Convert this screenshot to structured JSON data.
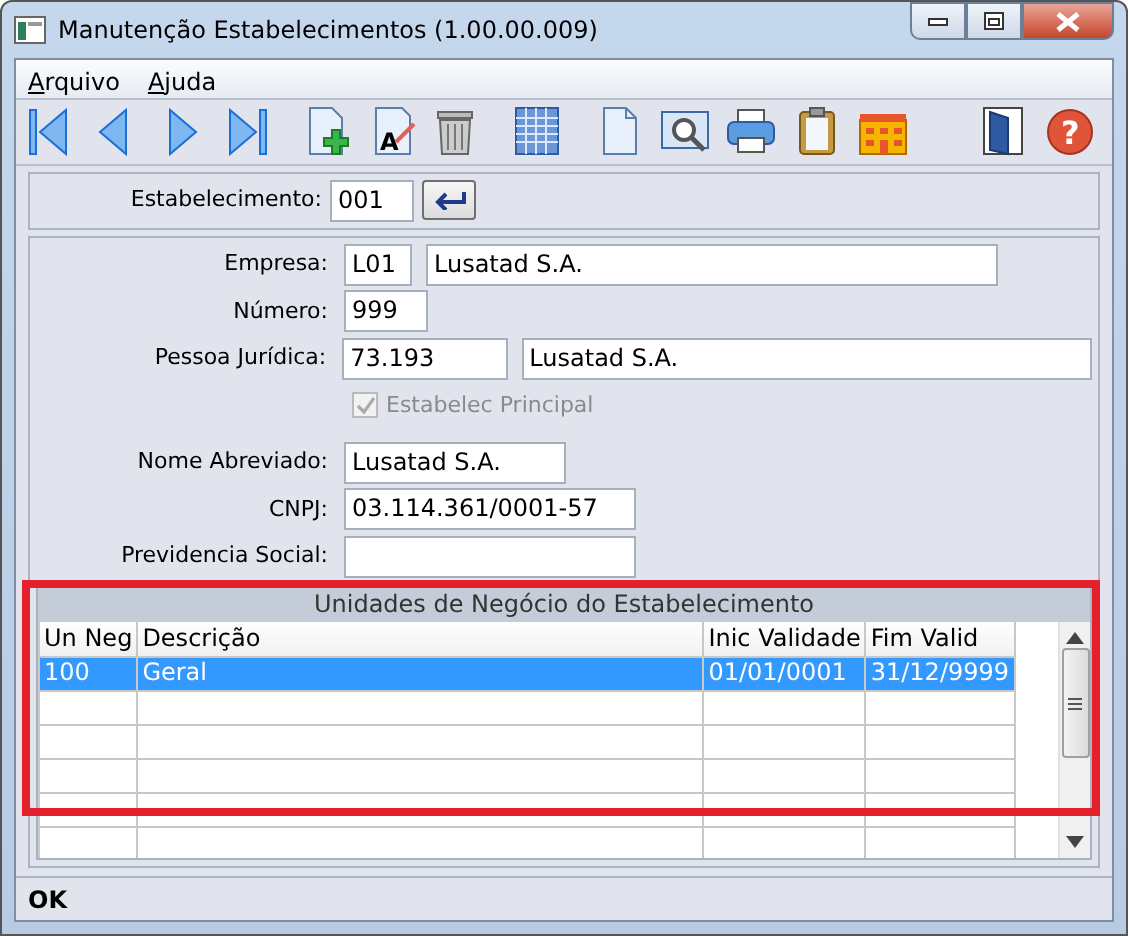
{
  "window": {
    "title": "Manutenção Estabelecimentos (1.00.00.009)"
  },
  "menu": [
    {
      "label": "Arquivo"
    },
    {
      "label": "Ajuda"
    }
  ],
  "toolbar": [
    {
      "kind": "first"
    },
    {
      "kind": "previous"
    },
    {
      "kind": "next"
    },
    {
      "kind": "last"
    },
    {
      "kind": "add"
    },
    {
      "kind": "edit",
      "glyph": "A"
    },
    {
      "kind": "trash"
    },
    {
      "kind": "grid"
    },
    {
      "kind": "document"
    },
    {
      "kind": "preview"
    },
    {
      "kind": "printer"
    },
    {
      "kind": "clipboard"
    },
    {
      "kind": "building"
    },
    {
      "kind": "door"
    },
    {
      "kind": "help",
      "glyph": "?"
    }
  ],
  "lookup": {
    "label": "Estabelecimento:",
    "value": "001"
  },
  "fields": [
    {
      "kind": "text",
      "label": "Empresa:",
      "values": [
        "L01",
        "Lusatad S.A."
      ]
    },
    {
      "kind": "text",
      "label": "Número:",
      "values": [
        "999"
      ]
    },
    {
      "kind": "text",
      "label": "Pessoa Jurídica:",
      "values": [
        "73.193",
        "Lusatad S.A."
      ]
    },
    {
      "kind": "checkbox",
      "label": "Estabelec Principal",
      "checked": true,
      "disabled": true
    },
    {
      "kind": "text",
      "label": "Nome Abreviado:",
      "values": [
        "Lusatad S.A."
      ]
    },
    {
      "kind": "text",
      "label": "CNPJ:",
      "values": [
        "03.114.361/0001-57"
      ]
    },
    {
      "kind": "text",
      "label": "Previdencia Social:"
    }
  ],
  "grid": {
    "title": "Unidades de Negócio do Estabelecimento",
    "highlighted": true,
    "columns": [
      "Un Neg",
      "Descrição",
      "Inic Validade",
      "Fim Valid"
    ],
    "rows": [
      {
        "cells": [
          "100",
          "Geral",
          "01/01/0001",
          "31/12/9999"
        ],
        "selected": true
      }
    ]
  },
  "status_bar": {
    "text": "OK"
  }
}
